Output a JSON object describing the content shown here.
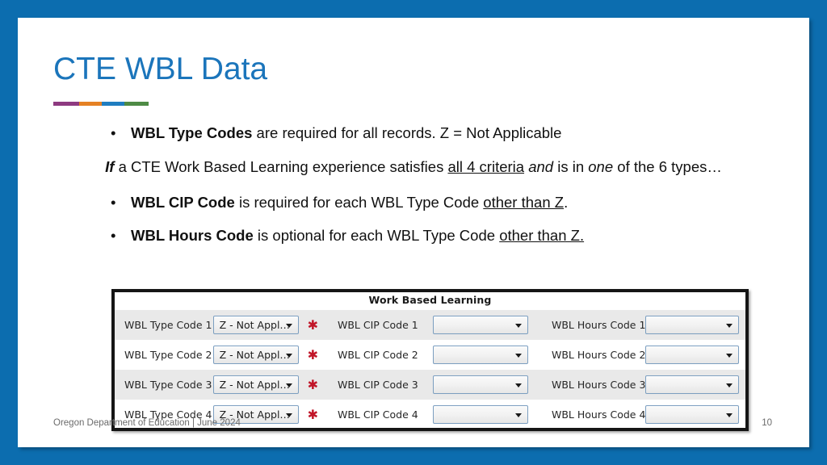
{
  "slide": {
    "title": "CTE WBL Data",
    "accent_blue": "#1B75BB",
    "border_blue": "#0C6DAF",
    "rule_colors": [
      "#8E3A80",
      "#E58124",
      "#1F7DC0",
      "#4E8B45"
    ]
  },
  "body": {
    "bullet_char": "•",
    "line1": {
      "bold_lead": "WBL Type Codes",
      "rest": " are required for all records. Z = Not Applicable"
    },
    "line2": {
      "if": "If",
      "part1": " a CTE Work Based Learning experience satisfies ",
      "underlined": "all 4 criteria",
      "and": "and",
      "part2": " is in ",
      "one": "one",
      "part3": " of the 6 types…"
    },
    "line3": {
      "bold_lead": "WBL CIP Code",
      "mid": " is required for each WBL Type Code ",
      "underlined": "other than Z",
      "tail": "."
    },
    "line4": {
      "bold_lead": "WBL Hours Code",
      "mid": " is optional for each WBL Type Code ",
      "underlined": "other than Z.",
      "tail": ""
    }
  },
  "form": {
    "header_title": "Work Based Learning",
    "required_marker": "✱",
    "rows": [
      {
        "type_label": "WBL Type Code 1",
        "type_value": "Z - Not Appl…",
        "cip_label": "WBL CIP Code 1",
        "cip_value": "",
        "hours_label": "WBL Hours Code 1",
        "hours_value": ""
      },
      {
        "type_label": "WBL Type Code 2",
        "type_value": "Z - Not Appl…",
        "cip_label": "WBL CIP Code 2",
        "cip_value": "",
        "hours_label": "WBL Hours Code 2",
        "hours_value": ""
      },
      {
        "type_label": "WBL Type Code 3",
        "type_value": "Z - Not Appl…",
        "cip_label": "WBL CIP Code 3",
        "cip_value": "",
        "hours_label": "WBL Hours Code 3",
        "hours_value": ""
      },
      {
        "type_label": "WBL Type Code 4",
        "type_value": "Z - Not Appl…",
        "cip_label": "WBL CIP Code 4",
        "cip_value": "",
        "hours_label": "WBL Hours Code 4",
        "hours_value": ""
      }
    ]
  },
  "footer": {
    "text": "Oregon Department of Education | June 2024",
    "page_number": "10"
  }
}
